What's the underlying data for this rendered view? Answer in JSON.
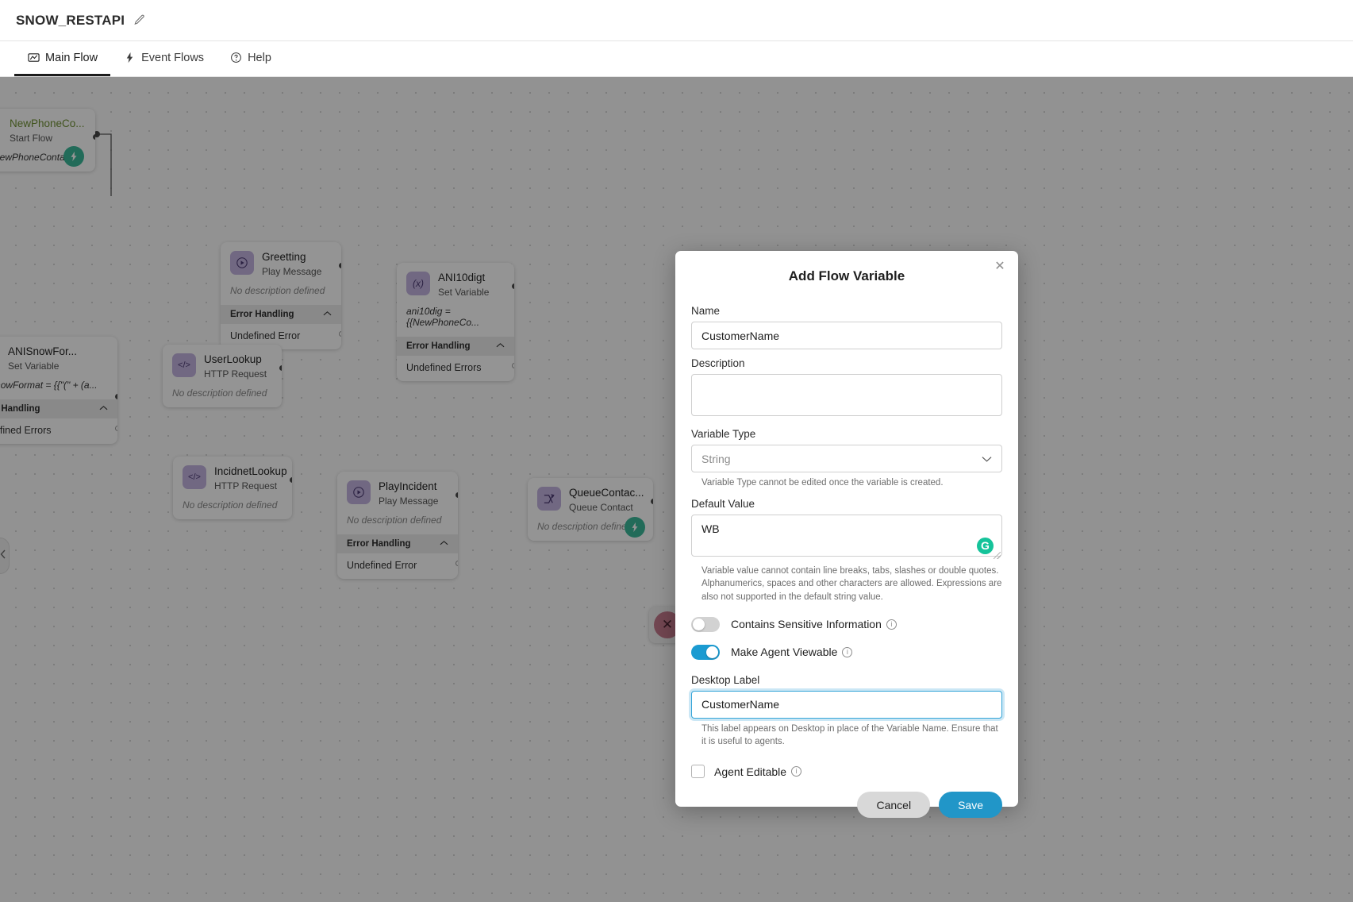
{
  "header": {
    "flow_title": "SNOW_RESTAPI",
    "edit_icon": "pencil-icon"
  },
  "tabs": [
    {
      "label": "Main Flow",
      "icon": "flow-icon",
      "active": true
    },
    {
      "label": "Event Flows",
      "icon": "bolt-icon",
      "active": false
    },
    {
      "label": "Help",
      "icon": "help-icon",
      "active": false
    }
  ],
  "canvas": {
    "collapse_handle_icon": "chevron-left-icon",
    "nodes": [
      {
        "title": "NewPhoneCo...",
        "subtitle": "Start Flow",
        "description": "t = NewPhoneContact",
        "icon": "start-flow-icon",
        "badge": "bolt-icon"
      },
      {
        "title": "Greetting",
        "subtitle": "Play Message",
        "description": "No description defined",
        "icon": "play-message-icon",
        "error_section": "Error Handling",
        "error_item": "Undefined Error"
      },
      {
        "title": "ANI10digt",
        "subtitle": "Set Variable",
        "description": "ani10dig = {{NewPhoneCo...",
        "icon": "set-variable-icon",
        "error_section": "Error Handling",
        "error_item": "Undefined Errors"
      },
      {
        "title": "ANISnowFor...",
        "subtitle": "Set Variable",
        "description": "aniSnowFormat = {{\"(\" + (a...",
        "icon": "set-variable-icon",
        "error_section": "Error Handling",
        "error_item": "Undefined Errors"
      },
      {
        "title": "UserLookup",
        "subtitle": "HTTP Request",
        "description": "No description defined",
        "icon": "http-request-icon"
      },
      {
        "title": "IncidnetLookup",
        "subtitle": "HTTP Request",
        "description": "No description defined",
        "icon": "http-request-icon"
      },
      {
        "title": "PlayIncident",
        "subtitle": "Play Message",
        "description": "No description defined",
        "icon": "play-message-icon",
        "error_section": "Error Handling",
        "error_item": "Undefined Error"
      },
      {
        "title": "QueueContac...",
        "subtitle": "Queue Contact",
        "description": "No description defined",
        "icon": "queue-contact-icon",
        "badge": "bolt-icon"
      },
      {
        "title": "",
        "subtitle": "",
        "icon": "disconnect-icon"
      }
    ]
  },
  "modal": {
    "title": "Add Flow Variable",
    "close_icon": "close-icon",
    "name": {
      "label": "Name",
      "value": "CustomerName",
      "placeholder": ""
    },
    "description": {
      "label": "Description",
      "value": "",
      "placeholder": ""
    },
    "variable_type": {
      "label": "Variable Type",
      "value": "String",
      "hint": "Variable Type cannot be edited once the variable is created.",
      "chevron_icon": "chevron-down-icon"
    },
    "default_value": {
      "label": "Default Value",
      "value": "WB",
      "hint": "Variable value cannot contain line breaks, tabs, slashes or double quotes. Alphanumerics, spaces and other characters are allowed. Expressions are also not supported in the default string value.",
      "assistant_icon": "grammarly-icon",
      "assistant_glyph": "G"
    },
    "sensitive_toggle": {
      "label": "Contains Sensitive Information",
      "state": "off",
      "info_icon": "info-icon"
    },
    "agent_viewable_toggle": {
      "label": "Make Agent Viewable",
      "state": "on",
      "info_icon": "info-icon"
    },
    "desktop_label": {
      "label": "Desktop Label",
      "value": "CustomerName",
      "hint": "This label appears on Desktop in place of the Variable Name. Ensure that it is useful to agents.",
      "focused": true
    },
    "agent_editable": {
      "label": "Agent Editable",
      "checked": false,
      "info_icon": "info-icon"
    },
    "cancel_label": "Cancel",
    "save_label": "Save"
  },
  "colors": {
    "accent_blue": "#2196c8",
    "toggle_on": "#1b9bd1",
    "node_icon": "#c3b3e0",
    "green_badge": "#3bb99a",
    "grammarly_green": "#15c39a",
    "terminal_red": "#c4798c"
  }
}
